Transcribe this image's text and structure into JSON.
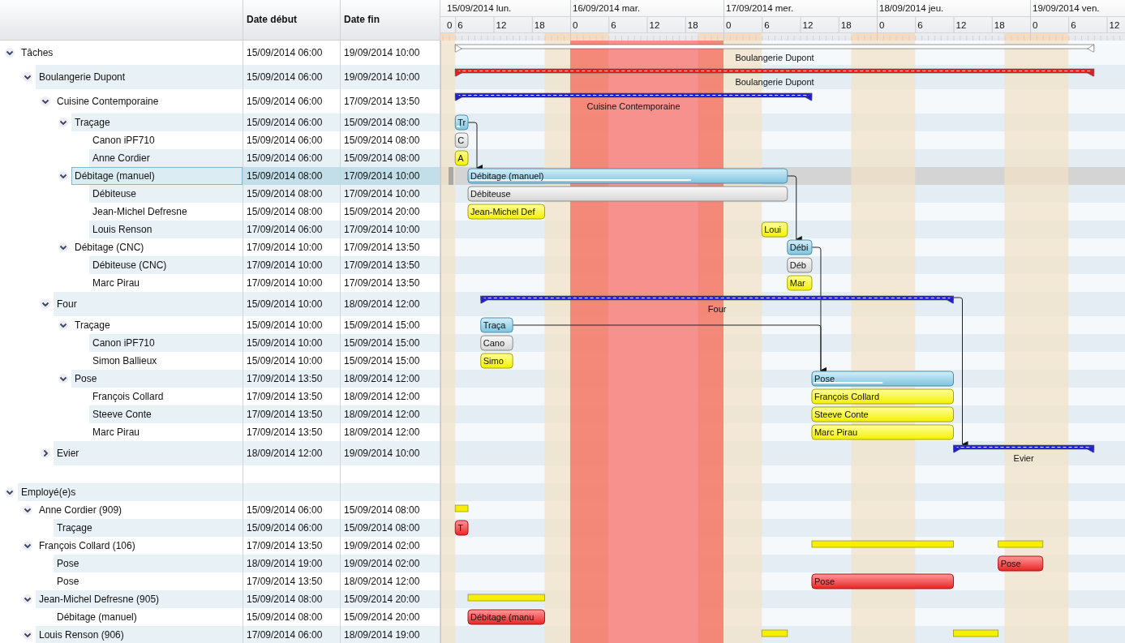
{
  "columns": [
    "Date début",
    "Date fin"
  ],
  "calendar": {
    "days": [
      {
        "date": "15/09/2014 lun.",
        "kind": "workday",
        "hours": [
          "0",
          "6",
          "12",
          "18"
        ]
      },
      {
        "date": "16/09/2014 mar.",
        "kind": "holiday",
        "hours": [
          "0",
          "6",
          "12",
          "18"
        ]
      },
      {
        "date": "17/09/2014 mer.",
        "kind": "workday",
        "hours": [
          "0",
          "6",
          "12",
          "18"
        ]
      },
      {
        "date": "18/09/2014 jeu.",
        "kind": "workday",
        "hours": [
          "0",
          "6",
          "12",
          "18"
        ]
      },
      {
        "date": "19/09/2014 ven.",
        "kind": "workday",
        "hours": [
          "0",
          "6",
          "12"
        ]
      }
    ]
  },
  "tree": [
    {
      "label": "Tâches",
      "start": "15/09/2014 06:00",
      "end": "19/09/2014 10:00",
      "expanded": true,
      "selected": false,
      "bars": [
        {
          "kind": "summary",
          "color": "#ffffff",
          "label": "Boulangerie Dupont"
        }
      ],
      "children": [
        {
          "label": "Boulangerie Dupont",
          "start": "15/09/2014 06:00",
          "end": "19/09/2014 10:00",
          "expanded": true,
          "selected": false,
          "bars": [
            {
              "kind": "summary",
              "color": "#e02020",
              "label": "Boulangerie Dupont"
            }
          ],
          "children": [
            {
              "label": "Cuisine Contemporaine",
              "start": "15/09/2014 06:00",
              "end": "17/09/2014 13:50",
              "expanded": true,
              "selected": false,
              "bars": [
                {
                  "kind": "summary",
                  "color": "#2020d0",
                  "label": "Cuisine Contemporaine"
                }
              ],
              "children": [
                {
                  "label": "Traçage",
                  "start": "15/09/2014 06:00",
                  "end": "15/09/2014 08:00",
                  "expanded": true,
                  "selected": false,
                  "bars": [
                    {
                      "kind": "task",
                      "label": "Tr",
                      "level": 0.3
                    }
                  ],
                  "children": [
                    {
                      "label": "Canon iPF710",
                      "start": "15/09/2014 06:00",
                      "end": "15/09/2014 08:00",
                      "selected": false,
                      "bars": [
                        {
                          "kind": "machine",
                          "label": "C"
                        }
                      ]
                    },
                    {
                      "label": "Anne Cordier",
                      "start": "15/09/2014 06:00",
                      "end": "15/09/2014 08:00",
                      "selected": false,
                      "bars": [
                        {
                          "kind": "person",
                          "label": "A"
                        }
                      ]
                    }
                  ]
                },
                {
                  "label": "Débitage (manuel)",
                  "start": "15/09/2014 08:00",
                  "end": "17/09/2014 10:00",
                  "expanded": true,
                  "selected": true,
                  "bars": [
                    {
                      "kind": "task",
                      "label": "Débitage (manuel)",
                      "level": 0.7
                    }
                  ],
                  "children": [
                    {
                      "label": "Débiteuse",
                      "start": "15/09/2014 08:00",
                      "end": "17/09/2014 10:00",
                      "selected": false,
                      "bars": [
                        {
                          "kind": "machine",
                          "label": "Débiteuse"
                        }
                      ]
                    },
                    {
                      "label": "Jean-Michel Defresne",
                      "start": "15/09/2014 08:00",
                      "end": "15/09/2014 20:00",
                      "selected": false,
                      "bars": [
                        {
                          "kind": "person",
                          "label": "Jean-Michel Def"
                        }
                      ]
                    },
                    {
                      "label": "Louis Renson",
                      "start": "17/09/2014 06:00",
                      "end": "17/09/2014 10:00",
                      "selected": false,
                      "bars": [
                        {
                          "kind": "person",
                          "label": "Loui"
                        }
                      ]
                    }
                  ]
                },
                {
                  "label": "Débitage (CNC)",
                  "start": "17/09/2014 10:00",
                  "end": "17/09/2014 13:50",
                  "expanded": true,
                  "selected": false,
                  "bars": [
                    {
                      "kind": "task",
                      "label": "Débi"
                    }
                  ],
                  "children": [
                    {
                      "label": "Débiteuse (CNC)",
                      "start": "17/09/2014 10:00",
                      "end": "17/09/2014 13:50",
                      "selected": false,
                      "bars": [
                        {
                          "kind": "machine",
                          "label": "Déb"
                        }
                      ]
                    },
                    {
                      "label": "Marc Pirau",
                      "start": "17/09/2014 10:00",
                      "end": "17/09/2014 13:50",
                      "selected": false,
                      "bars": [
                        {
                          "kind": "person",
                          "label": "Mar"
                        }
                      ]
                    }
                  ]
                }
              ]
            },
            {
              "label": "Four",
              "start": "15/09/2014 10:00",
              "end": "18/09/2014 12:00",
              "expanded": true,
              "selected": false,
              "bars": [
                {
                  "kind": "summary",
                  "color": "#2020d0",
                  "label": "Four"
                }
              ],
              "children": [
                {
                  "label": "Traçage",
                  "start": "15/09/2014 10:00",
                  "end": "15/09/2014 15:00",
                  "expanded": true,
                  "selected": false,
                  "bars": [
                    {
                      "kind": "task",
                      "label": "Traça"
                    }
                  ],
                  "children": [
                    {
                      "label": "Canon iPF710",
                      "start": "15/09/2014 10:00",
                      "end": "15/09/2014 15:00",
                      "selected": false,
                      "bars": [
                        {
                          "kind": "machine",
                          "label": "Cano"
                        }
                      ]
                    },
                    {
                      "label": "Simon Ballieux",
                      "start": "15/09/2014 10:00",
                      "end": "15/09/2014 15:00",
                      "selected": false,
                      "bars": [
                        {
                          "kind": "person",
                          "label": "Simo"
                        }
                      ]
                    }
                  ]
                },
                {
                  "label": "Pose",
                  "start": "17/09/2014 13:50",
                  "end": "18/09/2014 12:00",
                  "expanded": true,
                  "selected": false,
                  "bars": [
                    {
                      "kind": "task",
                      "label": "Pose",
                      "level": 0.5
                    }
                  ],
                  "children": [
                    {
                      "label": "François Collard",
                      "start": "17/09/2014 13:50",
                      "end": "18/09/2014 12:00",
                      "selected": false,
                      "bars": [
                        {
                          "kind": "person",
                          "label": "François Collard"
                        }
                      ]
                    },
                    {
                      "label": "Steeve Conte",
                      "start": "17/09/2014 13:50",
                      "end": "18/09/2014 12:00",
                      "selected": false,
                      "bars": [
                        {
                          "kind": "person",
                          "label": "Steeve Conte"
                        }
                      ]
                    },
                    {
                      "label": "Marc Pirau",
                      "start": "17/09/2014 13:50",
                      "end": "18/09/2014 12:00",
                      "selected": false,
                      "bars": [
                        {
                          "kind": "person",
                          "label": "Marc Pirau"
                        }
                      ]
                    }
                  ]
                }
              ]
            },
            {
              "label": "Evier",
              "start": "18/09/2014 12:00",
              "end": "19/09/2014 10:00",
              "expanded": false,
              "selected": false,
              "bars": [
                {
                  "kind": "summary",
                  "color": "#2020d0",
                  "label": "Evier"
                }
              ]
            }
          ]
        }
      ]
    },
    {
      "label": "Employé(e)s",
      "expanded": true,
      "selected": false,
      "children": [
        {
          "label": "Anne Cordier (909)",
          "start": "15/09/2014 06:00",
          "end": "15/09/2014 08:00",
          "expanded": true,
          "selected": false,
          "bars": [
            {
              "kind": "load"
            }
          ],
          "children": [
            {
              "label": "Traçage",
              "start": "15/09/2014 06:00",
              "end": "15/09/2014 08:00",
              "selected": false,
              "bars": [
                {
                  "kind": "assignment",
                  "label": "T"
                }
              ]
            }
          ]
        },
        {
          "label": "François Collard (106)",
          "start": "17/09/2014 13:50",
          "end": "19/09/2014 02:00",
          "expanded": true,
          "selected": false,
          "bars": [
            {
              "kind": "load"
            },
            {
              "kind": "load"
            }
          ],
          "children": [
            {
              "label": "Pose",
              "start": "18/09/2014 19:00",
              "end": "19/09/2014 02:00",
              "selected": false,
              "bars": [
                {
                  "kind": "assignment",
                  "label": "Pose"
                }
              ]
            },
            {
              "label": "Pose",
              "start": "17/09/2014 13:50",
              "end": "18/09/2014 12:00",
              "selected": false,
              "bars": [
                {
                  "kind": "assignment",
                  "label": "Pose"
                }
              ]
            }
          ]
        },
        {
          "label": "Jean-Michel Defresne (905)",
          "start": "15/09/2014 08:00",
          "end": "15/09/2014 20:00",
          "expanded": true,
          "selected": false,
          "bars": [
            {
              "kind": "load"
            }
          ],
          "children": [
            {
              "label": "Débitage (manuel)",
              "start": "15/09/2014 08:00",
              "end": "15/09/2014 20:00",
              "selected": false,
              "bars": [
                {
                  "kind": "assignment",
                  "label": "Débitage (manu"
                }
              ]
            }
          ]
        },
        {
          "label": "Louis Renson (906)",
          "start": "17/09/2014 06:00",
          "end": "18/09/2014 19:00",
          "expanded": true,
          "selected": false,
          "bars": [
            {
              "kind": "load"
            },
            {
              "kind": "load"
            }
          ]
        }
      ]
    }
  ]
}
